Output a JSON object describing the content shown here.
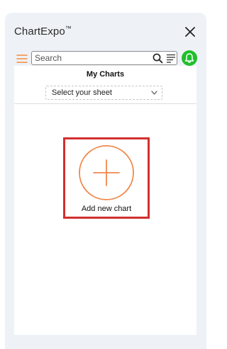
{
  "app": {
    "title": "ChartExpo",
    "trademark": "™"
  },
  "toolbar": {
    "search_placeholder": "Search",
    "notification_color": "#1fbf2b",
    "menu_color": "#f58a3c"
  },
  "main": {
    "section_title": "My Charts",
    "sheet_select": {
      "selected": "Select your sheet"
    },
    "add_chart": {
      "label": "Add new chart",
      "accent_color": "#f0884a",
      "highlight_color": "#d32f2f"
    }
  },
  "icons": {
    "close": "close-icon",
    "menu": "hamburger-menu-icon",
    "search": "search-icon",
    "filter": "filter-lines-icon",
    "notification": "bell-icon",
    "dropdown": "chevron-down-icon",
    "add": "plus-circle-icon"
  }
}
